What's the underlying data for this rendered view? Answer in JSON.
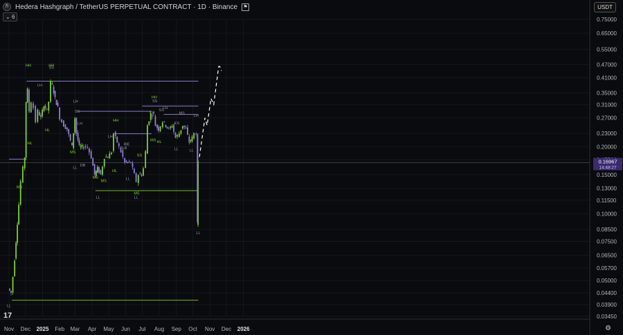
{
  "header": {
    "logo_icon": "hedera-logo-icon",
    "title": "Hedera Hashgraph / TetherUS PERPETUAL CONTRACT · 1D · Binance",
    "flag_icon": "flag-icon",
    "indicators_label": "6",
    "indicators_icon": "chevron-down-icon"
  },
  "currency": "USDT",
  "price_tag": {
    "price": "0.16967",
    "countdown": "14:48:27"
  },
  "colors": {
    "up": "#7ed321",
    "down": "#8f7ed8",
    "bos": "#9b84e0",
    "grid": "#16171c",
    "price_line": "#3a3d48"
  },
  "chart_data": {
    "type": "candlestick",
    "title": "Hedera Hashgraph / TetherUS PERPETUAL CONTRACT · 1D · Binance",
    "y_scale": "log",
    "y_ticks": [
      "0.75000",
      "0.65000",
      "0.55000",
      "0.47000",
      "0.41000",
      "0.35000",
      "0.31000",
      "0.27000",
      "0.23000",
      "0.20000",
      "0.17500",
      "0.15000",
      "0.13000",
      "0.11500",
      "0.10000",
      "0.08500",
      "0.07500",
      "0.06500",
      "0.05700",
      "0.05000",
      "0.04400",
      "0.03900",
      "0.03450"
    ],
    "x_ticks": [
      "Nov",
      "Dec",
      "2025",
      "Feb",
      "Mar",
      "Apr",
      "May",
      "Jun",
      "Jul",
      "Aug",
      "Sep",
      "Oct",
      "Nov",
      "Dec",
      "2026"
    ],
    "last_price": 0.16967,
    "price_path": [
      [
        "2024-11-01",
        0.046
      ],
      [
        "2024-11-06",
        0.044
      ],
      [
        "2024-11-10",
        0.052
      ],
      [
        "2024-11-15",
        0.075
      ],
      [
        "2024-11-20",
        0.11
      ],
      [
        "2024-11-24",
        0.14
      ],
      [
        "2024-11-28",
        0.16
      ],
      [
        "2024-12-01",
        0.18
      ],
      [
        "2024-12-03",
        0.32
      ],
      [
        "2024-12-06",
        0.36
      ],
      [
        "2024-12-09",
        0.29
      ],
      [
        "2024-12-13",
        0.32
      ],
      [
        "2024-12-17",
        0.3
      ],
      [
        "2024-12-21",
        0.26
      ],
      [
        "2024-12-25",
        0.29
      ],
      [
        "2024-12-30",
        0.27
      ],
      [
        "2025-01-05",
        0.31
      ],
      [
        "2025-01-10",
        0.29
      ],
      [
        "2025-01-14",
        0.32
      ],
      [
        "2025-01-17",
        0.39
      ],
      [
        "2025-01-20",
        0.38
      ],
      [
        "2025-01-25",
        0.33
      ],
      [
        "2025-01-30",
        0.3
      ],
      [
        "2025-02-03",
        0.27
      ],
      [
        "2025-02-10",
        0.25
      ],
      [
        "2025-02-16",
        0.24
      ],
      [
        "2025-02-25",
        0.2
      ],
      [
        "2025-03-02",
        0.27
      ],
      [
        "2025-03-05",
        0.23
      ],
      [
        "2025-03-10",
        0.2
      ],
      [
        "2025-03-15",
        0.2
      ],
      [
        "2025-03-25",
        0.2
      ],
      [
        "2025-04-01",
        0.18
      ],
      [
        "2025-04-07",
        0.15
      ],
      [
        "2025-04-12",
        0.16
      ],
      [
        "2025-04-18",
        0.15
      ],
      [
        "2025-04-25",
        0.18
      ],
      [
        "2025-05-01",
        0.18
      ],
      [
        "2025-05-08",
        0.19
      ],
      [
        "2025-05-12",
        0.23
      ],
      [
        "2025-05-18",
        0.21
      ],
      [
        "2025-05-25",
        0.19
      ],
      [
        "2025-06-01",
        0.17
      ],
      [
        "2025-06-06",
        0.17
      ],
      [
        "2025-06-12",
        0.17
      ],
      [
        "2025-06-18",
        0.15
      ],
      [
        "2025-06-22",
        0.14
      ],
      [
        "2025-06-26",
        0.15
      ],
      [
        "2025-07-01",
        0.15
      ],
      [
        "2025-07-05",
        0.16
      ],
      [
        "2025-07-09",
        0.19
      ],
      [
        "2025-07-12",
        0.25
      ],
      [
        "2025-07-18",
        0.28
      ],
      [
        "2025-07-23",
        0.28
      ],
      [
        "2025-07-27",
        0.25
      ],
      [
        "2025-08-01",
        0.24
      ],
      [
        "2025-08-09",
        0.26
      ],
      [
        "2025-08-14",
        0.25
      ],
      [
        "2025-08-20",
        0.24
      ],
      [
        "2025-08-26",
        0.25
      ],
      [
        "2025-09-01",
        0.22
      ],
      [
        "2025-09-08",
        0.23
      ],
      [
        "2025-09-14",
        0.25
      ],
      [
        "2025-09-20",
        0.24
      ],
      [
        "2025-09-26",
        0.21
      ],
      [
        "2025-10-01",
        0.22
      ],
      [
        "2025-10-05",
        0.23
      ],
      [
        "2025-10-09",
        0.23
      ],
      [
        "2025-10-10",
        0.09
      ],
      [
        "2025-10-11",
        0.17
      ]
    ],
    "levels": [
      {
        "price": 0.395,
        "from": "2024-12-03",
        "to": "2025-10-11",
        "color": "bos"
      },
      {
        "price": 0.305,
        "from": "2025-07-01",
        "to": "2025-10-11",
        "color": "bos"
      },
      {
        "price": 0.289,
        "from": "2025-03-05",
        "to": "2025-07-18",
        "color": "bos"
      },
      {
        "price": 0.28,
        "from": "2025-08-09",
        "to": "2025-10-11",
        "color": "bos"
      },
      {
        "price": 0.229,
        "from": "2025-05-12",
        "to": "2025-07-18",
        "color": "bos"
      },
      {
        "price": 0.176,
        "from": "2024-11-01",
        "to": "2024-12-01",
        "color": "bos"
      },
      {
        "price": 0.127,
        "from": "2025-04-07",
        "to": "2025-10-11",
        "color": "up"
      },
      {
        "price": 0.0408,
        "from": "2024-11-06",
        "to": "2025-10-11",
        "color": "up"
      }
    ],
    "labels": [
      {
        "text": "HH",
        "date": "2024-12-06",
        "price": 0.46,
        "color": "up"
      },
      {
        "text": "HH",
        "date": "2025-01-17",
        "price": 0.46,
        "color": "up"
      },
      {
        "text": "SS",
        "date": "2025-01-17",
        "price": 0.45,
        "color": "text"
      },
      {
        "text": "LH",
        "date": "2024-12-27",
        "price": 0.375,
        "color": "text"
      },
      {
        "text": "HL",
        "date": "2025-01-10",
        "price": 0.235,
        "color": "up"
      },
      {
        "text": "HL",
        "date": "2024-12-09",
        "price": 0.205,
        "color": "up"
      },
      {
        "text": "MS",
        "date": "2024-11-20",
        "price": 0.13,
        "color": "up"
      },
      {
        "text": "LH",
        "date": "2025-03-02",
        "price": 0.316,
        "color": "text"
      },
      {
        "text": "SS",
        "date": "2025-03-05",
        "price": 0.285,
        "color": "text"
      },
      {
        "text": "LH",
        "date": "2025-03-10",
        "price": 0.252,
        "color": "text"
      },
      {
        "text": "MS",
        "date": "2025-02-25",
        "price": 0.187,
        "color": "up"
      },
      {
        "text": "LL",
        "date": "2025-03-01",
        "price": 0.159,
        "color": "text"
      },
      {
        "text": "DB",
        "date": "2025-03-15",
        "price": 0.163,
        "color": "text"
      },
      {
        "text": "MS",
        "date": "2025-04-07",
        "price": 0.144,
        "color": "up"
      },
      {
        "text": "MS",
        "date": "2025-04-22",
        "price": 0.139,
        "color": "up"
      },
      {
        "text": "LL",
        "date": "2025-04-12",
        "price": 0.117,
        "color": "text"
      },
      {
        "text": "LH",
        "date": "2025-05-04",
        "price": 0.22,
        "color": "text"
      },
      {
        "text": "HH",
        "date": "2025-05-14",
        "price": 0.26,
        "color": "up"
      },
      {
        "text": "HL",
        "date": "2025-05-12",
        "price": 0.154,
        "color": "up"
      },
      {
        "text": "LL",
        "date": "2025-06-05",
        "price": 0.142,
        "color": "text"
      },
      {
        "text": "IBE",
        "date": "2025-06-03",
        "price": 0.203,
        "color": "text"
      },
      {
        "text": "TLB",
        "date": "2025-05-28",
        "price": 0.195,
        "color": "text"
      },
      {
        "text": "SS",
        "date": "2025-06-26",
        "price": 0.181,
        "color": "up"
      },
      {
        "text": "MS",
        "date": "2025-06-21",
        "price": 0.122,
        "color": "up"
      },
      {
        "text": "LL",
        "date": "2025-06-20",
        "price": 0.117,
        "color": "text"
      },
      {
        "text": "HH",
        "date": "2025-07-23",
        "price": 0.33,
        "color": "up"
      },
      {
        "text": "SS",
        "date": "2025-07-24",
        "price": 0.318,
        "color": "text"
      },
      {
        "text": "LH",
        "date": "2025-07-19",
        "price": 0.282,
        "color": "text"
      },
      {
        "text": "SS",
        "date": "2025-08-05",
        "price": 0.289,
        "color": "text"
      },
      {
        "text": "LH",
        "date": "2025-08-12",
        "price": 0.296,
        "color": "text"
      },
      {
        "text": "MS",
        "date": "2025-07-21",
        "price": 0.212,
        "color": "up"
      },
      {
        "text": "HL",
        "date": "2025-08-01",
        "price": 0.208,
        "color": "up"
      },
      {
        "text": "MS",
        "date": "2025-09-11",
        "price": 0.28,
        "color": "text"
      },
      {
        "text": "ES",
        "date": "2025-09-02",
        "price": 0.253,
        "color": "text"
      },
      {
        "text": "LL",
        "date": "2025-09-01",
        "price": 0.193,
        "color": "text"
      },
      {
        "text": "LH",
        "date": "2025-10-07",
        "price": 0.273,
        "color": "text"
      },
      {
        "text": "LL",
        "date": "2025-09-29",
        "price": 0.19,
        "color": "text"
      },
      {
        "text": "LL",
        "date": "2025-10-11",
        "price": 0.081,
        "color": "text"
      },
      {
        "text": "LL",
        "date": "2024-11-01",
        "price": 0.038,
        "color": "text"
      }
    ],
    "projection": [
      [
        "2025-10-13",
        0.18
      ],
      [
        "2025-10-23",
        0.27
      ],
      [
        "2025-10-27",
        0.25
      ],
      [
        "2025-11-03",
        0.33
      ],
      [
        "2025-11-08",
        0.31
      ],
      [
        "2025-11-17",
        0.46
      ],
      [
        "2025-11-19",
        0.46
      ],
      [
        "2025-11-22",
        0.44
      ]
    ]
  }
}
